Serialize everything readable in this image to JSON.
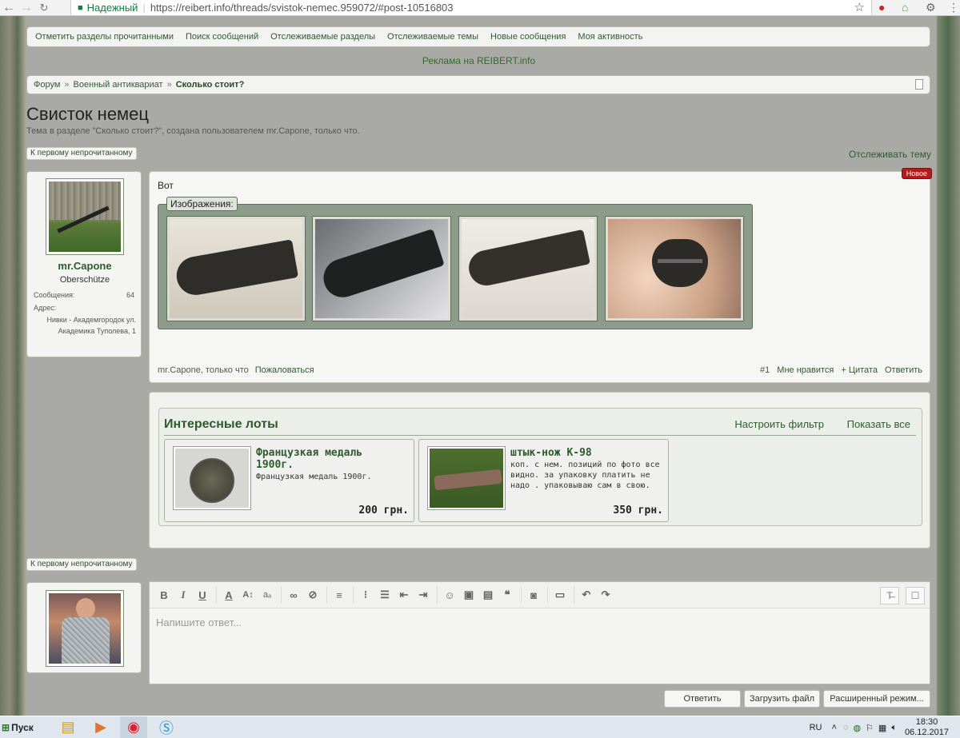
{
  "browser": {
    "secure_label": "Надежный",
    "url": "https://reibert.info/threads/svistok-nemec.959072/#post-10516803"
  },
  "quicklinks": [
    "Отметить разделы прочитанными",
    "Поиск сообщений",
    "Отслеживаемые разделы",
    "Отслеживаемые темы",
    "Новые сообщения",
    "Моя активность"
  ],
  "ad": "Реклама на REIBERT.info",
  "breadcrumb": {
    "items": [
      "Форум",
      "Военный антиквариат"
    ],
    "current": "Сколько стоит?"
  },
  "thread": {
    "title": "Свисток немец",
    "description": "Тема в разделе \"Сколько стоит?\", создана пользователем mr.Capone, только что.",
    "jump_unread": "К первому непрочитанному",
    "follow": "Отслеживать тему"
  },
  "author": {
    "name": "mr.Capone",
    "rank": "Oberschütze",
    "messages_label": "Сообщения:",
    "messages": "64",
    "address_label": "Адрес:",
    "address": "Нивки - Академгородок ул. Академика Туполева, 1"
  },
  "post": {
    "text": "Вот",
    "new_badge": "Новое",
    "images_label": "Изображения:",
    "footer_author": "mr.Capone, только что",
    "report": "Пожаловаться",
    "number": "#1",
    "like": "Мне нравится",
    "quote": "+ Цитата",
    "reply": "Ответить"
  },
  "lots": {
    "title": "Интересные лоты",
    "filter": "Настроить фильтр",
    "show_all": "Показать все",
    "items": [
      {
        "name": "Французкая медаль 1900г.",
        "desc": "Французкая медаль 1900г.",
        "price": "200 грн."
      },
      {
        "name": "штык-нож К-98",
        "desc": "коп. с нем. позиций по фото все видно. за упаковку платить не надо . упаковываю сам в свою.",
        "price": "350 грн."
      }
    ]
  },
  "reply": {
    "placeholder": "Напишите ответ...",
    "submit": "Ответить",
    "upload": "Загрузить файл",
    "advanced": "Расширенный режим..."
  },
  "taskbar": {
    "start": "Пуск",
    "lang": "RU",
    "time": "18:30",
    "date": "06.12.2017"
  }
}
